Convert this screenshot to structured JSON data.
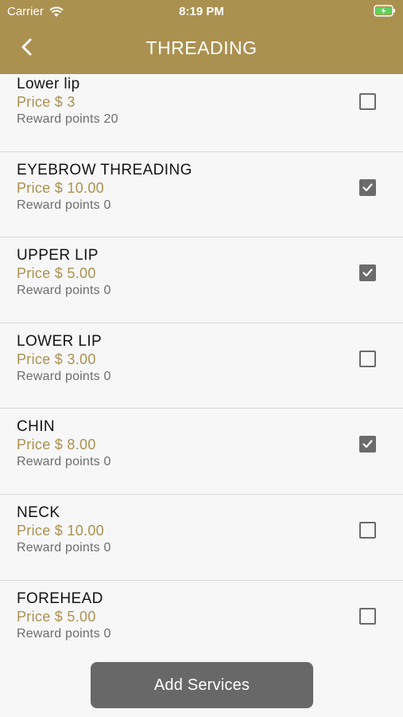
{
  "status": {
    "carrier": "Carrier",
    "time": "8:19 PM",
    "wifi_icon": "wifi-icon",
    "battery_icon": "battery-charging-icon"
  },
  "header": {
    "title": "THREADING",
    "back_icon": "chevron-left-icon",
    "background": "#ab9150"
  },
  "colors": {
    "price": "#ab9150",
    "button": "#686868"
  },
  "services": [
    {
      "name": "Lower lip",
      "price": "Price $ 3",
      "points": "Reward points 20",
      "checked": false
    },
    {
      "name": "EYEBROW THREADING",
      "price": "Price $ 10.00",
      "points": "Reward points 0",
      "checked": true
    },
    {
      "name": "UPPER LIP",
      "price": "Price $ 5.00",
      "points": "Reward points 0",
      "checked": true
    },
    {
      "name": "LOWER LIP",
      "price": "Price $ 3.00",
      "points": "Reward points 0",
      "checked": false
    },
    {
      "name": "CHIN",
      "price": "Price $ 8.00",
      "points": "Reward points 0",
      "checked": true
    },
    {
      "name": "NECK",
      "price": "Price $ 10.00",
      "points": "Reward points 0",
      "checked": false
    },
    {
      "name": "FOREHEAD",
      "price": "Price $ 5.00",
      "points": "Reward points 0",
      "checked": false
    }
  ],
  "footer": {
    "add_label": "Add Services"
  }
}
